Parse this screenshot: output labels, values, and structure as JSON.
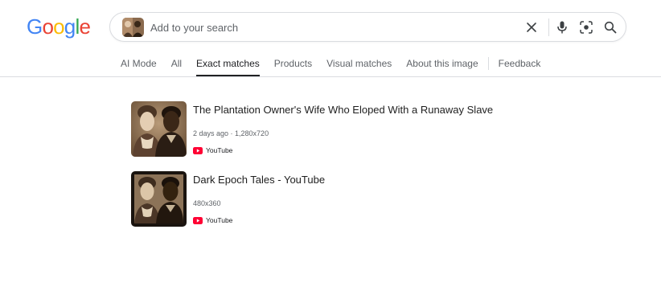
{
  "logo": {
    "letters": [
      "G",
      "o",
      "o",
      "g",
      "l",
      "e"
    ],
    "colors": [
      "#4285F4",
      "#EA4335",
      "#FBBC05",
      "#4285F4",
      "#34A853",
      "#EA4335"
    ]
  },
  "search": {
    "placeholder": "Add to your search",
    "value": "",
    "icons": [
      "close-icon",
      "microphone-icon",
      "lens-icon",
      "search-icon"
    ]
  },
  "tabs": {
    "items": [
      "AI Mode",
      "All",
      "Exact matches",
      "Products",
      "Visual matches",
      "About this image",
      "Feedback"
    ],
    "active": "Exact matches"
  },
  "results": [
    {
      "title": "The Plantation Owner's Wife Who Eloped With a Runaway Slave",
      "meta": "2 days ago · 1,280x720",
      "source": "YouTube",
      "source_icon": "youtube-icon"
    },
    {
      "title": "Dark Epoch Tales - YouTube",
      "meta": "480x360",
      "source": "YouTube",
      "source_icon": "youtube-icon"
    }
  ],
  "colors": {
    "youtube_red": "#FF0033",
    "active_tab": "#202124",
    "muted_text": "#5f6368"
  }
}
